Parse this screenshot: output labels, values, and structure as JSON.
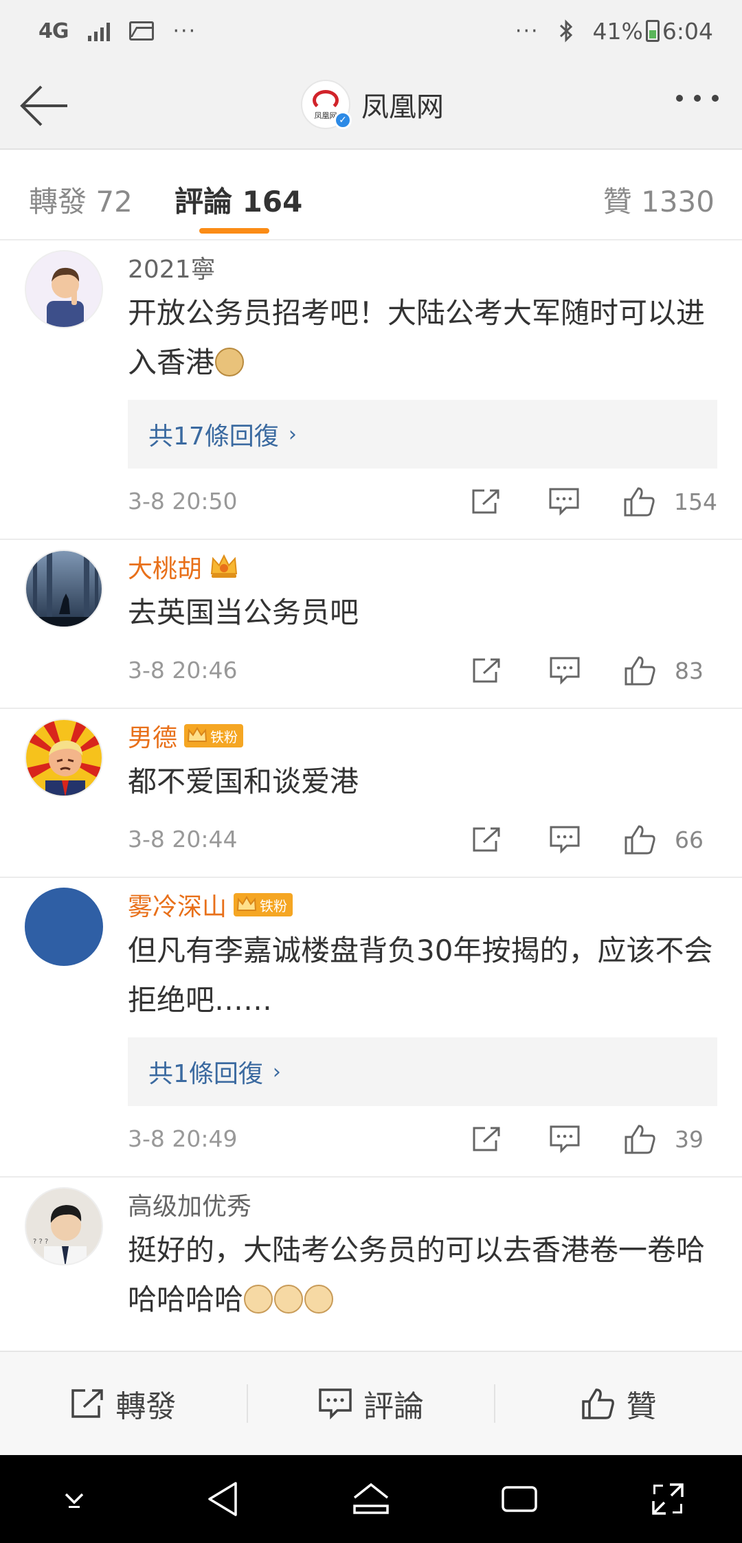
{
  "status_bar": {
    "network": "4G",
    "left_dots": "···",
    "right_dots": "···",
    "battery_pct": "41%",
    "time": "6:04"
  },
  "nav": {
    "title": "凤凰网",
    "logo_text": "凤凰网"
  },
  "tabs": {
    "repost": "轉發 72",
    "comments": "評論 164",
    "likes": "贊 1330"
  },
  "comments": [
    {
      "username": "2021寧",
      "text": "开放公务员招考吧！大陆公考大军随时可以进入香港",
      "emojis": [
        "doge"
      ],
      "reply": "共17條回復",
      "time": "3-8 20:50",
      "likes": "154"
    },
    {
      "username": "大桃胡",
      "text": "去英国当公务员吧",
      "badge": "crown",
      "time": "3-8 20:46",
      "likes": "83"
    },
    {
      "username": "男德",
      "text": "都不爱国和谈爱港",
      "badge_label": "铁粉",
      "time": "3-8 20:44",
      "likes": "66"
    },
    {
      "username": "雾冷深山",
      "text": "但凡有李嘉诚楼盘背负30年按揭的，应该不会拒绝吧……",
      "badge_label": "铁粉",
      "reply": "共1條回復",
      "time": "3-8 20:49",
      "likes": "39"
    },
    {
      "username": "高级加优秀",
      "text": "挺好的，大陆考公务员的可以去香港卷一卷哈哈哈哈哈",
      "emojis": [
        "cat",
        "cat",
        "cat"
      ]
    }
  ],
  "bottom_bar": {
    "repost": "轉發",
    "comment": "評論",
    "like": "贊"
  },
  "colors": {
    "accent_orange": "#fb8c16",
    "vip_name": "#e8701a",
    "reply_link": "#3b6aa0"
  }
}
